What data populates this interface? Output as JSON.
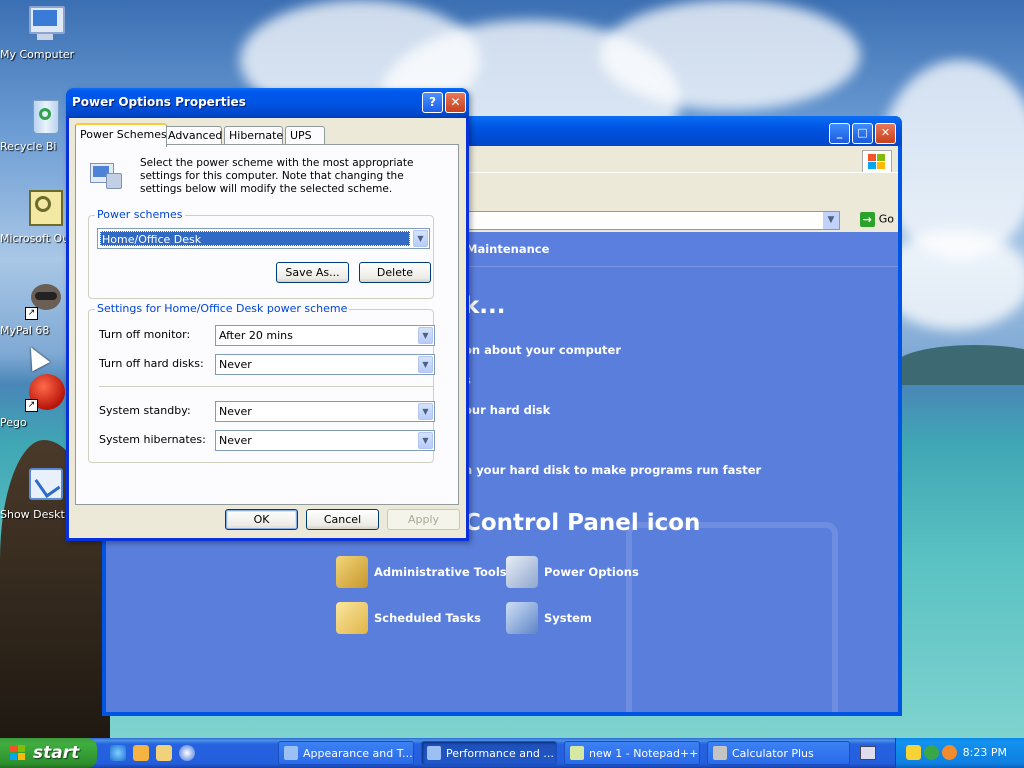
{
  "desktop": {
    "icons": [
      {
        "label": "My Computer"
      },
      {
        "label": "Recycle Bi"
      },
      {
        "label": "Microsoft Ou"
      },
      {
        "label": "MyPal 68"
      },
      {
        "label": "Pego"
      },
      {
        "label": "Show Deskt"
      }
    ]
  },
  "control_panel": {
    "address_go": "Go",
    "header": "Maintenance",
    "pick_task_fragment": "k...",
    "tasks": [
      "on about your computer",
      "s",
      "our hard disk",
      "n your hard disk to make programs run faster"
    ],
    "pick_icon_fragment": "Control Panel icon",
    "icons": [
      {
        "label": "Administrative Tools"
      },
      {
        "label": "Power Options"
      },
      {
        "label": "Scheduled Tasks"
      },
      {
        "label": "System"
      }
    ]
  },
  "dialog": {
    "title": "Power Options Properties",
    "help_glyph": "?",
    "close_glyph": "✕",
    "tabs": [
      "Power Schemes",
      "Advanced",
      "Hibernate",
      "UPS"
    ],
    "intro": "Select the power scheme with the most appropriate settings for this computer. Note that changing the settings below will modify the selected scheme.",
    "schemes_group": "Power schemes",
    "scheme_selected": "Home/Office Desk",
    "save_as": "Save As...",
    "delete": "Delete",
    "settings_group": "Settings for Home/Office Desk power scheme",
    "settings": [
      {
        "label": "Turn off monitor:",
        "value": "After 20 mins"
      },
      {
        "label": "Turn off hard disks:",
        "value": "Never"
      },
      {
        "label": "System standby:",
        "value": "Never"
      },
      {
        "label": "System hibernates:",
        "value": "Never"
      }
    ],
    "ok": "OK",
    "cancel": "Cancel",
    "apply": "Apply"
  },
  "taskbar": {
    "start": "start",
    "buttons": [
      {
        "label": "Appearance and T..."
      },
      {
        "label": "Performance and ..."
      },
      {
        "label": "new 1 - Notepad++"
      },
      {
        "label": "Calculator Plus"
      }
    ],
    "clock": "8:23 PM"
  },
  "colors": {
    "xp_blue": "#0054e3",
    "dialog_face": "#ece9d8",
    "tab_highlight": "#ffc83c",
    "group_title": "#0046d5",
    "selection": "#316ac5",
    "control_panel_body": "#5a7edc"
  },
  "icons": {
    "dropdown": "chevron-down-icon",
    "power_scheme": "power-scheme-icon",
    "go": "go-arrow-icon"
  }
}
